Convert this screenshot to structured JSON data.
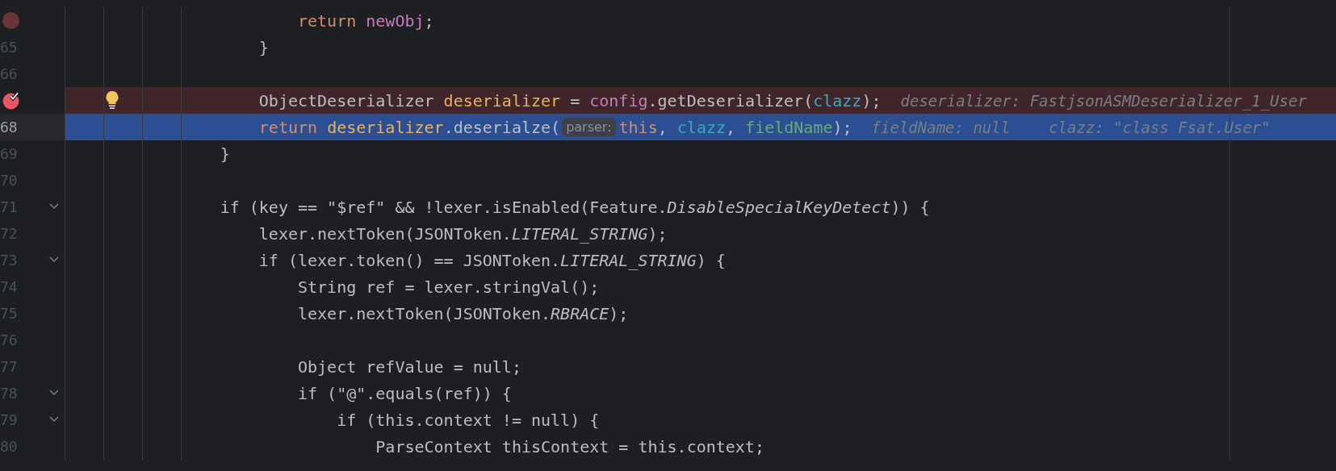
{
  "lines": [
    {
      "breakpoint": true,
      "muted": true,
      "current": false,
      "foldable": false,
      "intention": false,
      "parts": [
        {
          "kind": "code",
          "tokens": [
            {
              "text": "                        return ",
              "kind": "keyword"
            },
            {
              "text": "newObj",
              "kind": "member"
            },
            {
              "text": ";",
              "kind": "plain"
            }
          ]
        }
      ]
    },
    {
      "number": "65",
      "breakpoint": false,
      "current": false,
      "foldable": false,
      "intention": false,
      "parts": [
        {
          "kind": "code",
          "tokens": [
            {
              "text": "                    }",
              "kind": "plain"
            }
          ]
        }
      ]
    },
    {
      "number": "66",
      "breakpoint": false,
      "current": false,
      "foldable": false,
      "intention": false
    },
    {
      "breakpoint": true,
      "muted": false,
      "current": false,
      "foldable": false,
      "intention": true,
      "parts": [
        {
          "kind": "code",
          "tokens": [
            {
              "text": "                    ObjectDeserializer ",
              "kind": "plain"
            },
            {
              "text": "deserializer",
              "kind": "local"
            },
            {
              "text": " = ",
              "kind": "plain"
            },
            {
              "text": "config",
              "kind": "member"
            },
            {
              "text": ".getDeserializer(",
              "kind": "plain"
            },
            {
              "text": "clazz",
              "kind": "param"
            },
            {
              "text": ");",
              "kind": "plain"
            }
          ]
        },
        {
          "kind": "inlay",
          "text": "deserializer: FastjsonASMDeserializer_1_User"
        }
      ]
    },
    {
      "number": "68",
      "breakpoint": false,
      "current": true,
      "foldable": false,
      "intention": false,
      "parts": [
        {
          "kind": "code",
          "tokens": [
            {
              "text": "                    return ",
              "kind": "keyword"
            },
            {
              "text": "deserializer",
              "kind": "local"
            },
            {
              "text": ".deserialze(",
              "kind": "plain"
            }
          ]
        },
        {
          "kind": "chip",
          "text": "parser:"
        },
        {
          "kind": "code",
          "tokens": [
            {
              "text": "this",
              "kind": "keyword"
            },
            {
              "text": ", ",
              "kind": "plain"
            },
            {
              "text": "clazz",
              "kind": "param"
            },
            {
              "text": ", ",
              "kind": "plain"
            },
            {
              "text": "fieldName",
              "kind": "field"
            },
            {
              "text": ");",
              "kind": "plain"
            }
          ]
        },
        {
          "kind": "inlay",
          "text": "fieldName: null"
        },
        {
          "kind": "inlay",
          "text": "clazz: \"class Fsat.User\""
        }
      ]
    },
    {
      "number": "69",
      "breakpoint": false,
      "current": false,
      "foldable": false,
      "intention": false,
      "parts": [
        {
          "kind": "code",
          "tokens": [
            {
              "text": "                }",
              "kind": "plain"
            }
          ]
        }
      ]
    },
    {
      "number": "70",
      "breakpoint": false,
      "current": false,
      "foldable": false,
      "intention": false
    },
    {
      "number": "71",
      "breakpoint": false,
      "current": false,
      "foldable": true,
      "intention": false,
      "parts": [
        {
          "kind": "code",
          "tokens": [
            {
              "text": "                if (key == \"$ref\" && !lexer.isEnabled(Feature.",
              "kind": "plain"
            },
            {
              "text": "DisableSpecialKeyDetect",
              "kind": "constant"
            },
            {
              "text": ")) {",
              "kind": "plain"
            }
          ]
        }
      ]
    },
    {
      "number": "72",
      "breakpoint": false,
      "current": false,
      "foldable": false,
      "intention": false,
      "parts": [
        {
          "kind": "code",
          "tokens": [
            {
              "text": "                    lexer.nextToken(JSONToken.",
              "kind": "plain"
            },
            {
              "text": "LITERAL_STRING",
              "kind": "constant"
            },
            {
              "text": ");",
              "kind": "plain"
            }
          ]
        }
      ]
    },
    {
      "number": "73",
      "breakpoint": false,
      "current": false,
      "foldable": true,
      "intention": false,
      "parts": [
        {
          "kind": "code",
          "tokens": [
            {
              "text": "                    if (lexer.token() == JSONToken.",
              "kind": "plain"
            },
            {
              "text": "LITERAL_STRING",
              "kind": "constant"
            },
            {
              "text": ") {",
              "kind": "plain"
            }
          ]
        }
      ]
    },
    {
      "number": "74",
      "breakpoint": false,
      "current": false,
      "foldable": false,
      "intention": false,
      "parts": [
        {
          "kind": "code",
          "tokens": [
            {
              "text": "                        String ref = lexer.stringVal();",
              "kind": "plain"
            }
          ]
        }
      ]
    },
    {
      "number": "75",
      "breakpoint": false,
      "current": false,
      "foldable": false,
      "intention": false,
      "parts": [
        {
          "kind": "code",
          "tokens": [
            {
              "text": "                        lexer.nextToken(JSONToken.",
              "kind": "plain"
            },
            {
              "text": "RBRACE",
              "kind": "constant"
            },
            {
              "text": ");",
              "kind": "plain"
            }
          ]
        }
      ]
    },
    {
      "number": "76",
      "breakpoint": false,
      "current": false,
      "foldable": false,
      "intention": false
    },
    {
      "number": "77",
      "breakpoint": false,
      "current": false,
      "foldable": false,
      "intention": false,
      "parts": [
        {
          "kind": "code",
          "tokens": [
            {
              "text": "                        Object refValue = null;",
              "kind": "plain"
            }
          ]
        }
      ]
    },
    {
      "number": "78",
      "breakpoint": false,
      "current": false,
      "foldable": true,
      "intention": false,
      "parts": [
        {
          "kind": "code",
          "tokens": [
            {
              "text": "                        if (\"@\".equals(ref)) {",
              "kind": "plain"
            }
          ]
        }
      ]
    },
    {
      "number": "79",
      "breakpoint": false,
      "current": false,
      "foldable": true,
      "intention": false,
      "parts": [
        {
          "kind": "code",
          "tokens": [
            {
              "text": "                            if (this.context != null) {",
              "kind": "plain"
            }
          ]
        }
      ]
    },
    {
      "number": "80",
      "breakpoint": false,
      "current": false,
      "foldable": false,
      "intention": false,
      "parts": [
        {
          "kind": "code",
          "tokens": [
            {
              "text": "                                ParseContext thisContext = this.context;",
              "kind": "plain"
            }
          ]
        }
      ]
    }
  ]
}
